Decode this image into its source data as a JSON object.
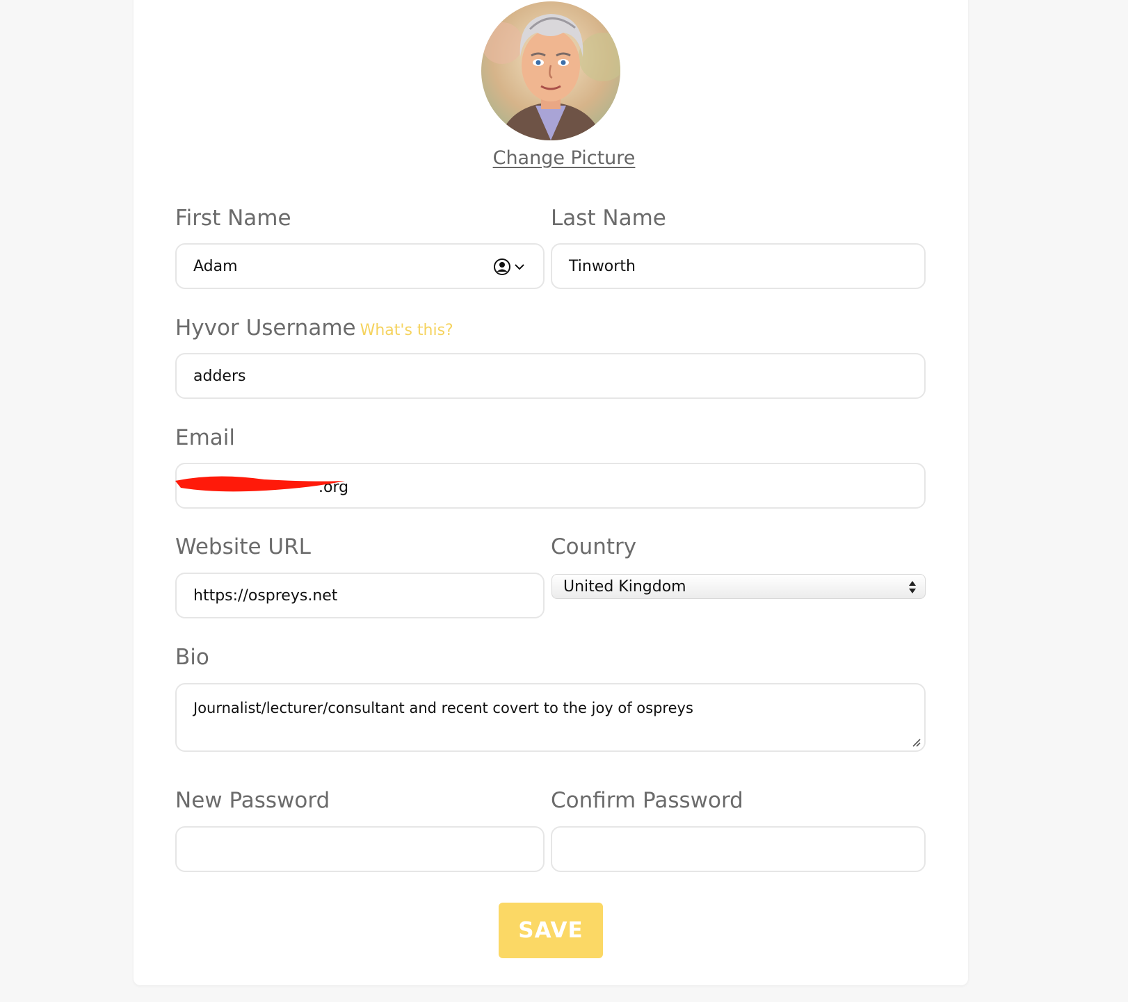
{
  "profile": {
    "avatar_icon": "user-avatar-illustration",
    "change_picture_label": "Change Picture"
  },
  "fields": {
    "first_name": {
      "label": "First Name",
      "value": "Adam",
      "autofill_icon": "contact-autofill-icon"
    },
    "last_name": {
      "label": "Last Name",
      "value": "Tinworth"
    },
    "username": {
      "label": "Hyvor Username",
      "hint": "What's this?",
      "value": "adders"
    },
    "email": {
      "label": "Email",
      "value_visible_fragment": ".org"
    },
    "website": {
      "label": "Website URL",
      "value": "https://ospreys.net"
    },
    "country": {
      "label": "Country",
      "value": "United Kingdom"
    },
    "bio": {
      "label": "Bio",
      "value": "Journalist/lecturer/consultant and recent covert to the joy of ospreys"
    },
    "new_password": {
      "label": "New Password",
      "value": ""
    },
    "confirm_password": {
      "label": "Confirm Password",
      "value": ""
    }
  },
  "actions": {
    "save_label": "SAVE"
  },
  "colors": {
    "accent": "#fbd865",
    "hint": "#f5d35f",
    "redaction": "#ff1a0a"
  }
}
